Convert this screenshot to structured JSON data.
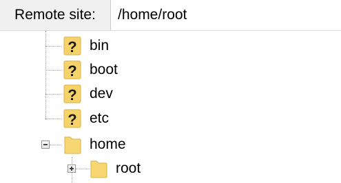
{
  "remote_site": {
    "label": "Remote site:",
    "path": "/home/root"
  },
  "tree": {
    "items": [
      {
        "label": "bin",
        "icon": "unknown-folder-icon"
      },
      {
        "label": "boot",
        "icon": "unknown-folder-icon"
      },
      {
        "label": "dev",
        "icon": "unknown-folder-icon"
      },
      {
        "label": "etc",
        "icon": "unknown-folder-icon"
      },
      {
        "label": "home",
        "icon": "folder-icon",
        "expanded": true,
        "children": [
          {
            "label": "root",
            "icon": "folder-icon",
            "expanded": false,
            "selected": true
          }
        ]
      }
    ]
  },
  "colors": {
    "question_mark": "#1a1a1a",
    "question_bg": "#f5d36a",
    "folder": "#f7d774",
    "folder_edge": "#d8b24a"
  }
}
